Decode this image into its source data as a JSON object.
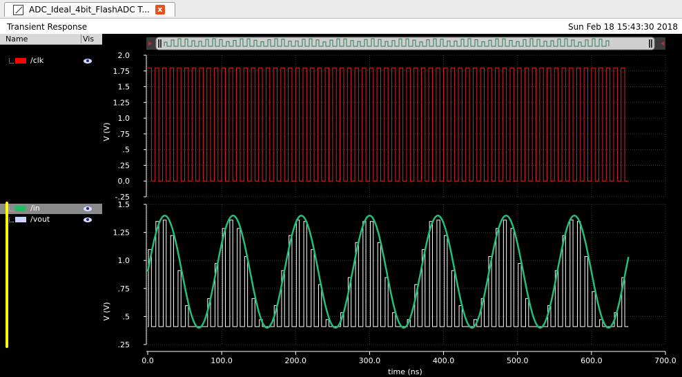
{
  "tab": {
    "title": "ADC_Ideal_4bit_FlashADC T...",
    "close_label": "x"
  },
  "window": {
    "title": "Transient Response",
    "timestamp": "Sun Feb 18 15:43:30 2018"
  },
  "signal_panel": {
    "col_name": "Name",
    "col_vis": "Vis",
    "signals": [
      {
        "name": "/clk",
        "color": "#ff0000"
      },
      {
        "name": "/in",
        "color": "#22bb66",
        "selected": true
      },
      {
        "name": "/vout",
        "color": "#c8d4ff"
      }
    ]
  },
  "chart_data": [
    {
      "type": "line",
      "series": [
        {
          "name": "/clk",
          "color": "#e02020",
          "period_ns": 10,
          "low": 0.0,
          "high": 1.8,
          "x_end": 650
        }
      ],
      "ylabel": "V (V)",
      "y_ticks": [
        "2.0",
        "1.75",
        "1.5",
        "1.25",
        "1.0",
        ".75",
        ".5",
        ".25",
        "0.0",
        "-.25"
      ],
      "ylim": [
        -0.25,
        2.0
      ],
      "grid": true
    },
    {
      "type": "line",
      "series": [
        {
          "name": "/in",
          "color": "#22c07a",
          "offset": 0.9,
          "amplitude": 0.5,
          "period_ns": 92.3,
          "x_end": 650
        },
        {
          "name": "/vout",
          "color": "#ffffff",
          "sample_ns": 10,
          "x_end": 650
        }
      ],
      "ylabel": "V (V)",
      "y_ticks": [
        "1.5",
        "1.25",
        "1.0",
        ".75",
        ".5",
        ".25"
      ],
      "ylim": [
        0.25,
        1.5
      ],
      "grid": true
    }
  ],
  "x_axis": {
    "label": "time (ns)",
    "ticks": [
      "0.0",
      "100.0",
      "200.0",
      "300.0",
      "400.0",
      "500.0",
      "600.0",
      "700.0"
    ],
    "xlim": [
      0,
      700
    ]
  }
}
